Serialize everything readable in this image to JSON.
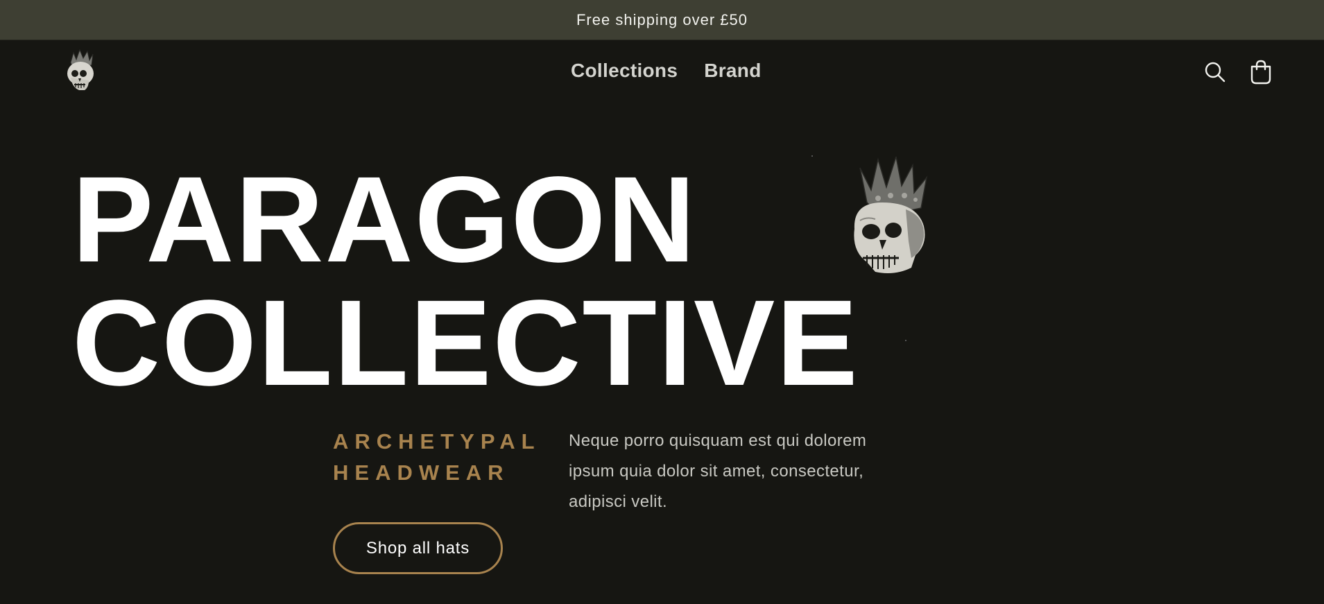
{
  "announcement": {
    "text": "Free shipping over £50"
  },
  "header": {
    "logo_icon": "crowned-skull-icon",
    "nav": [
      {
        "label": "Collections"
      },
      {
        "label": "Brand"
      }
    ],
    "search_icon": "search-icon",
    "cart_icon": "cart-bag-icon"
  },
  "hero": {
    "title_line1": "PARAGON",
    "title_line2": "COLLECTIVE",
    "image_icon": "crowned-skull-icon",
    "subtitle_line1": "ARCHETYPAL",
    "subtitle_line2": "HEADWEAR",
    "description": "Neque porro quisquam est qui dolorem ipsum quia dolor sit amet, consectetur, adipisci velit.",
    "cta_label": "Shop all hats"
  },
  "colors": {
    "background": "#161612",
    "announcement_bg": "#3e3f33",
    "accent": "#a8834e",
    "text": "#ffffff"
  }
}
